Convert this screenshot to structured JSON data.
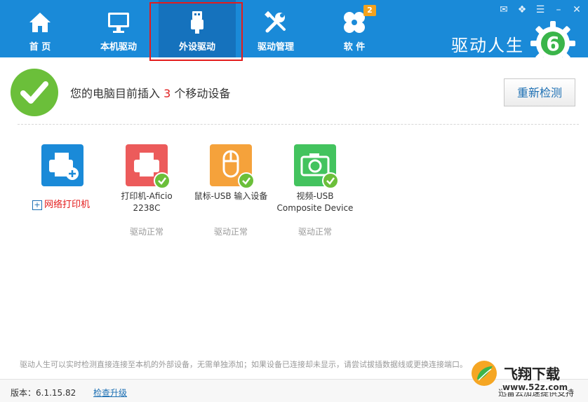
{
  "colors": {
    "topbar": "#1a8ad8",
    "active_tab": "#1572bd",
    "accent_red": "#e31c1c",
    "ok_green": "#6bbf3a"
  },
  "nav": {
    "tabs": [
      {
        "label": "首 页",
        "icon": "home-icon"
      },
      {
        "label": "本机驱动",
        "icon": "monitor-icon"
      },
      {
        "label": "外设驱动",
        "icon": "usb-icon",
        "active": true
      },
      {
        "label": "驱动管理",
        "icon": "tools-icon"
      },
      {
        "label": "软 件",
        "icon": "apps-icon",
        "badge": "2"
      }
    ],
    "brand": "驱动人生",
    "brand_logo_digit": "6"
  },
  "status": {
    "prefix": "您的电脑目前插入",
    "count": "3",
    "suffix": "个移动设备",
    "redetect_label": "重新检测"
  },
  "devices": [
    {
      "name": "网络打印机",
      "icon": "network-printer-icon",
      "color": "#1a8ad8",
      "add": true
    },
    {
      "name_line1": "打印机-Aficio",
      "name_line2": "2238C",
      "state": "驱动正常",
      "icon": "printer-icon",
      "color": "#ec5b5b"
    },
    {
      "name_line1": "鼠标-USB 输入设备",
      "name_line2": "",
      "state": "驱动正常",
      "icon": "mouse-icon",
      "color": "#f5a23b"
    },
    {
      "name_line1": "视频-USB",
      "name_line2": "Composite Device",
      "state": "驱动正常",
      "icon": "camera-icon",
      "color": "#43c35e"
    }
  ],
  "tip": "驱动人生可以实时检测直接连接至本机的外部设备，无需单独添加；如果设备已连接却未显示，请尝试拔插数据线或更换连接端口。",
  "footer": {
    "version": "版本：6.1.15.82",
    "upgrade": "检查升级",
    "partial_text": "迅雷云加速提供支持"
  },
  "watermark": {
    "title": "飞翔下载",
    "url": "www.52z.com"
  }
}
